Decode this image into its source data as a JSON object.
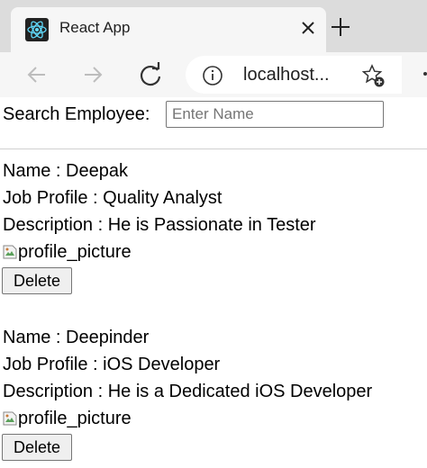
{
  "browser": {
    "tab_title": "React App",
    "address": "localhost..."
  },
  "search": {
    "label": "Search Employee:",
    "placeholder": "Enter Name",
    "value": ""
  },
  "employees": [
    {
      "name_line": "Name : Deepak",
      "job_line": "Job Profile : Quality Analyst",
      "desc_line": "Description : He is Passionate in Tester",
      "image_alt": "profile_picture",
      "delete_label": "Delete"
    },
    {
      "name_line": "Name : Deepinder",
      "job_line": "Job Profile : iOS Developer",
      "desc_line": "Description : He is a Dedicated iOS Developer",
      "image_alt": "profile_picture",
      "delete_label": "Delete"
    }
  ],
  "colors": {
    "react_logo": "#61dafb",
    "tabstrip_bg": "#dcdcdc",
    "toolbar_bg": "#f6f6f6"
  },
  "icons": {
    "favicon": "react-logo-icon",
    "close": "close-icon",
    "new_tab": "plus-icon",
    "back": "arrow-left-icon",
    "forward": "arrow-right-icon",
    "reload": "reload-icon",
    "info": "info-icon",
    "favorite": "star-add-icon",
    "broken_image": "broken-image-icon"
  }
}
